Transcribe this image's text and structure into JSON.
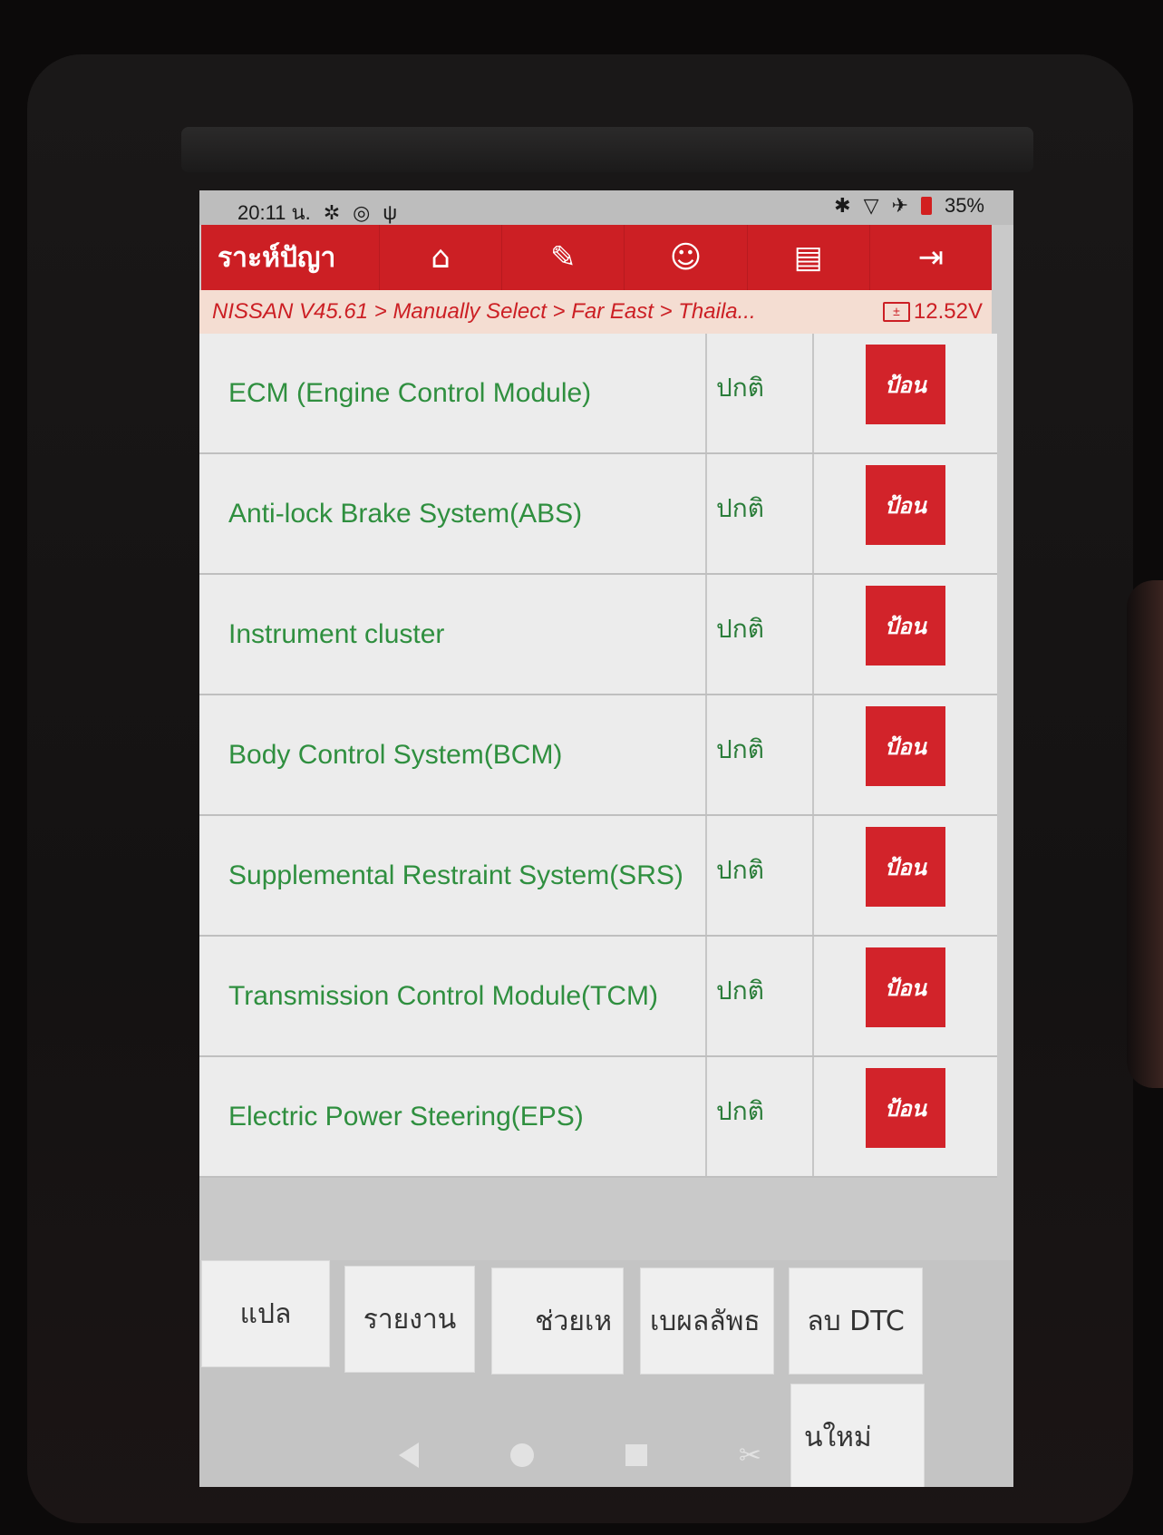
{
  "status_bar": {
    "time": "20:11 น.",
    "icons_left": [
      "gear-icon",
      "timer-icon",
      "usb-icon"
    ],
    "bluetooth": "✱",
    "wifi": "▽",
    "airplane": "✈",
    "battery": "35%"
  },
  "header": {
    "title": "ราะห์ปัญา",
    "tools": [
      {
        "icon": "home-icon",
        "glyph": "⌂"
      },
      {
        "icon": "edit-icon",
        "glyph": "✎"
      },
      {
        "icon": "support-icon",
        "glyph": "☺"
      },
      {
        "icon": "print-icon",
        "glyph": "▤"
      },
      {
        "icon": "exit-icon",
        "glyph": "⇥"
      }
    ]
  },
  "breadcrumb": {
    "path": "NISSAN V45.61 > Manually Select > Far East > Thaila...",
    "voltage": "12.52V"
  },
  "systems": [
    {
      "name": "ECM (Engine Control Module)",
      "status": "ปกติ",
      "action": "ป้อน"
    },
    {
      "name": "Anti-lock Brake System(ABS)",
      "status": "ปกติ",
      "action": "ป้อน"
    },
    {
      "name": "Instrument cluster",
      "status": "ปกติ",
      "action": "ป้อน"
    },
    {
      "name": "Body Control System(BCM)",
      "status": "ปกติ",
      "action": "ป้อน"
    },
    {
      "name": "Supplemental Restraint System(SRS)",
      "status": "ปกติ",
      "action": "ป้อน"
    },
    {
      "name": "Transmission Control Module(TCM)",
      "status": "ปกติ",
      "action": "ป้อน"
    },
    {
      "name": "Electric Power Steering(EPS)",
      "status": "ปกติ",
      "action": "ป้อน"
    }
  ],
  "bottom_buttons": {
    "translate": "แปล",
    "report": "รายงาน",
    "help": "ช่วยเห",
    "results": "เบผลลัพธ",
    "clear_dtc": "ลบ DTC",
    "new": "นใหม่"
  },
  "colors": {
    "accent": "#cc1f24",
    "system_text": "#2f8f3f"
  }
}
